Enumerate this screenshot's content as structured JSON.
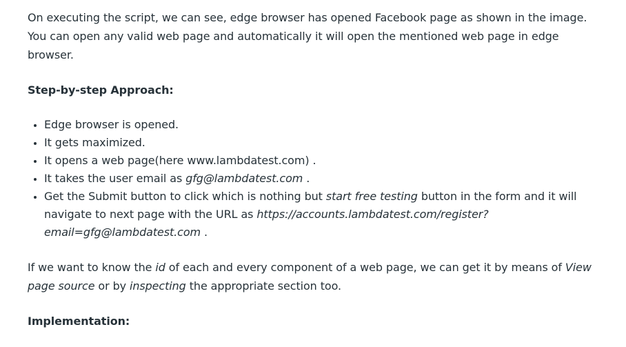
{
  "article": {
    "intro_paragraph": "On executing the script, we can see, edge browser has opened Facebook page as shown in the image. You can open any valid web page and automatically it will open the mentioned web page in edge browser.",
    "approach_heading": "Step-by-step Approach:",
    "steps": {
      "step1": "Edge browser is opened.",
      "step2": "It gets maximized.",
      "step3": "It opens a web page(here www.lambdatest.com) .",
      "step4_prefix": "It takes the user email as ",
      "step4_email": "gfg@lambdatest.com",
      "step4_suffix": " .",
      "step5_part1": "Get the Submit button to click which is nothing but ",
      "step5_italic1": "start free testing",
      "step5_part2": " button in the form and it will navigate to next page with the URL as ",
      "step5_url": "https://accounts.lambdatest.com/register?email=gfg@lambdatest.com",
      "step5_suffix": " ."
    },
    "id_paragraph": {
      "part1": "If we want to know the ",
      "italic_id": "id",
      "part2": " of each and every component of a web page, we can get it by means of ",
      "italic_view_source": "View page source",
      "part3": " or by ",
      "italic_inspecting": "inspecting",
      "part4": " the appropriate section too."
    },
    "implementation_heading": "Implementation:"
  }
}
